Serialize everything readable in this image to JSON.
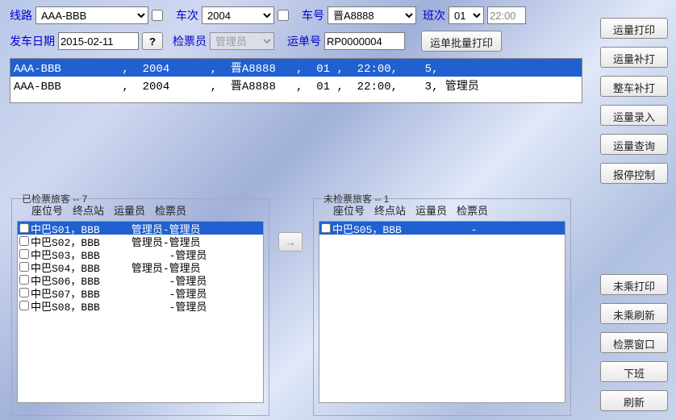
{
  "form": {
    "route_label": "线路",
    "route_value": "AAA-BBB",
    "trip_label": "车次",
    "trip_value": "2004",
    "vehno_label": "车号",
    "vehno_value": "晋A8888",
    "shift_label": "班次",
    "shift_value": "01",
    "time_value": "22:00",
    "depart_label": "发车日期",
    "depart_value": "2015-02-11",
    "q_label": "?",
    "inspector_label": "检票员",
    "inspector_value": "管理员",
    "waybill_label": "运单号",
    "waybill_value": "RP0000004",
    "batch_print": "运单批量打印"
  },
  "trips": [
    {
      "text": "AAA-BBB         ,  2004      ,  晋A8888   ,  01 ,  22:00,    5,",
      "selected": true
    },
    {
      "text": "AAA-BBB         ,  2004      ,  晋A8888   ,  01 ,  22:00,    3, 管理员",
      "selected": false
    }
  ],
  "checked_group": {
    "title": "已检票旅客 -- 7",
    "headers": [
      "座位号",
      "终点站",
      "运量员",
      "检票员"
    ],
    "rows": [
      {
        "text": "中巴S01，BBB     管理员-管理员",
        "selected": true
      },
      {
        "text": "中巴S02，BBB     管理员-管理员",
        "selected": false
      },
      {
        "text": "中巴S03，BBB           -管理员",
        "selected": false
      },
      {
        "text": "中巴S04，BBB     管理员-管理员",
        "selected": false
      },
      {
        "text": "中巴S06，BBB           -管理员",
        "selected": false
      },
      {
        "text": "中巴S07，BBB           -管理员",
        "selected": false
      },
      {
        "text": "中巴S08，BBB           -管理员",
        "selected": false
      }
    ]
  },
  "unchecked_group": {
    "title": "未检票旅客 -- 1",
    "headers": [
      "座位号",
      "终点站",
      "运量员",
      "检票员"
    ],
    "rows": [
      {
        "text": "中巴S05，BBB           -",
        "selected": true
      }
    ]
  },
  "arrow": "→",
  "right_buttons": [
    "运量打印",
    "运量补打",
    "整车补打",
    "运量录入",
    "运量查询",
    "报停控制"
  ],
  "bottom_buttons": [
    "未乘打印",
    "未乘刷新",
    "检票窗口",
    "下班",
    "刷新"
  ]
}
